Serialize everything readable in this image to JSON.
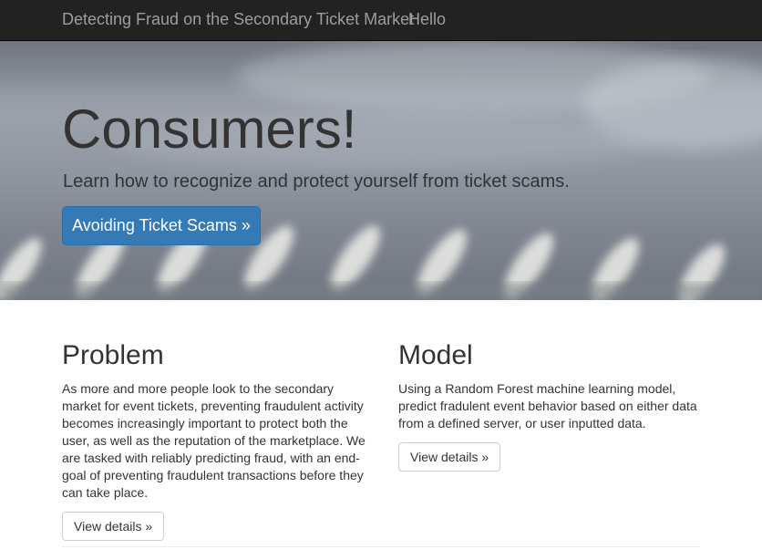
{
  "navbar": {
    "brand": "Detecting Fraud on the Secondary Ticket Market",
    "link": "Hello"
  },
  "hero": {
    "headline": "Consumers!",
    "lead": "Learn how to recognize and protect yourself from ticket scams.",
    "button_label": "Avoiding Ticket Scams »"
  },
  "columns": [
    {
      "title": "Problem",
      "body": "As more and more people look to the secondary market for event tickets, preventing fraudulent activity becomes increasingly important to protect both the user, as well as the reputation of the marketplace. We are tasked with reliably predicting fraud, with an end-goal of preventing fraudulent transactions before they can take place.",
      "button_label": "View details »"
    },
    {
      "title": "Model",
      "body": "Using a Random Forest machine learning model, predict fradulent event behavior based on either data from a defined server, or user inputted data.",
      "button_label": "View details »"
    }
  ],
  "colors": {
    "navbar_bg": "#222222",
    "navbar_text": "#9d9d9d",
    "primary": "#337ab7",
    "text": "#333333"
  }
}
